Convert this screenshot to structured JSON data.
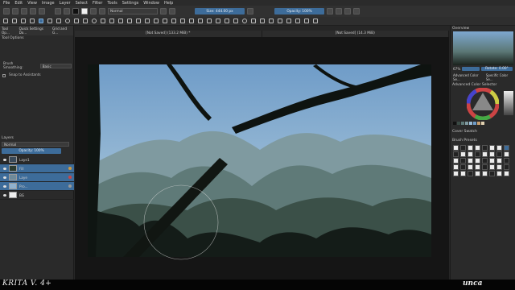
{
  "menu": [
    "File",
    "Edit",
    "View",
    "Image",
    "Layer",
    "Select",
    "Filter",
    "Tools",
    "Settings",
    "Window",
    "Help"
  ],
  "toolbar": {
    "blend_mode": "Normal",
    "size_label": "Size: 444.00 px",
    "opacity_label": "Opacity: 100%"
  },
  "left_docker": {
    "tabs": [
      "Tool Op...",
      "Quick Settings Do...",
      "Grid and G..."
    ],
    "title": "Tool Options",
    "smoothing_label": "Brush Smoothing:",
    "smoothing_value": "Basic",
    "snap_label": "Snap to Assistants",
    "layers_title": "Layers",
    "layer_blend": "Normal",
    "layer_opacity": "Opacity: 100%",
    "layers": [
      {
        "name": "Laye1",
        "selected": false
      },
      {
        "name": "Fill",
        "selected": true
      },
      {
        "name": "Laye",
        "selected": true
      },
      {
        "name": "Pro...",
        "selected": true
      },
      {
        "name": "BG",
        "selected": false
      }
    ]
  },
  "canvas": {
    "tabs": [
      "[Not Saved] (133.2 MiB) *",
      "[Not Saved] (14.3 MiB)"
    ]
  },
  "right_docker": {
    "overview_title": "Overview",
    "zoom": "67%",
    "rotation": "Rotate: 0.00°",
    "color_tabs": [
      "Advanced Color Se...",
      "Specific Color Se..."
    ],
    "color_selector_title": "Advanced Color Selector",
    "palette_title": "Cover Swatch",
    "presets_title": "Brush Presets",
    "colors": {
      "accent": "#3d6c9a",
      "sky": "#7ea8d0"
    }
  },
  "footer": {
    "product": "KRITA V. 4+",
    "brand": "unca"
  }
}
